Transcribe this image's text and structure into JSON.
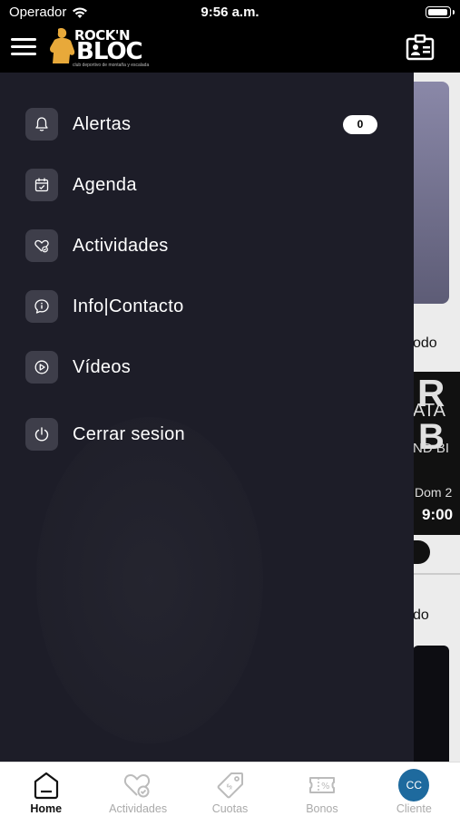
{
  "status_bar": {
    "carrier": "Operador",
    "time": "9:56 a.m."
  },
  "header": {
    "logo_line1": "ROCK'N",
    "logo_line2": "BLOC",
    "logo_tagline": "club deportivo de montaña y escalada"
  },
  "drawer": {
    "items": [
      {
        "label": "Alertas",
        "icon": "bell-icon",
        "badge": "0"
      },
      {
        "label": "Agenda",
        "icon": "calendar-icon"
      },
      {
        "label": "Actividades",
        "icon": "heart-check-icon"
      },
      {
        "label": "Info|Contacto",
        "icon": "info-chat-icon"
      },
      {
        "label": "Vídeos",
        "icon": "play-icon"
      },
      {
        "label": "Cerrar sesion",
        "icon": "power-icon"
      }
    ]
  },
  "background": {
    "text1": "odo",
    "text2": "ATA",
    "text3": "ND BI",
    "text4": "Dom 2",
    "text5": "9:00",
    "text6": "do",
    "big_text1": "R",
    "big_text2": "B"
  },
  "tab_bar": {
    "tabs": [
      {
        "label": "Home",
        "icon": "home-icon",
        "active": true
      },
      {
        "label": "Actividades",
        "icon": "heart-check-icon"
      },
      {
        "label": "Cuotas",
        "icon": "tag-icon"
      },
      {
        "label": "Bonos",
        "icon": "ticket-icon"
      },
      {
        "label": "Cliente",
        "icon": "avatar",
        "avatar_text": "CC"
      }
    ]
  },
  "colors": {
    "drawer_bg": "#1d1d28",
    "icon_bg": "#3e3e4a",
    "avatar_bg": "#1e6a9e"
  }
}
